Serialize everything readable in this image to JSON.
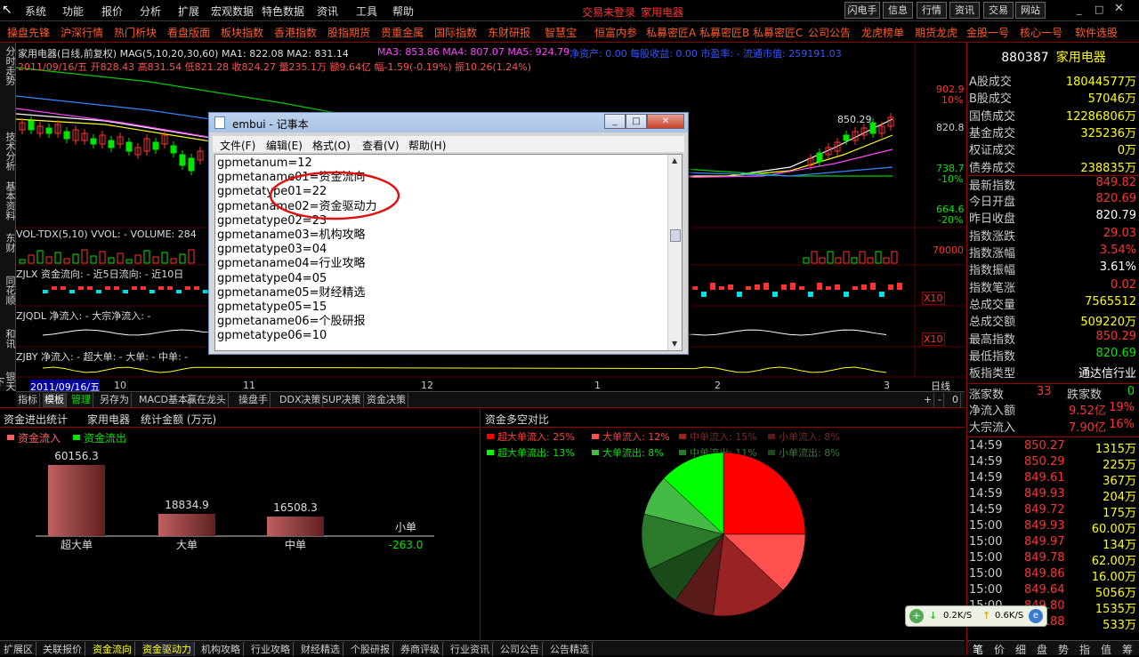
{
  "colors": {
    "up": "#ff3232",
    "down": "#00e600",
    "accent": "#ffff00",
    "nav": "#ff5a2a"
  },
  "menubar": {
    "items": [
      "系统",
      "功能",
      "报价",
      "分析",
      "扩展",
      "宏观数据",
      "特色数据",
      "资讯",
      "工具",
      "帮助"
    ],
    "status": "交易未登录",
    "stock": "家用电器",
    "buttons": [
      "闪电手",
      "信息",
      "行情",
      "资讯",
      "交易",
      "网站"
    ]
  },
  "navbar": {
    "items": [
      "操盘先锋",
      "沪深行情",
      "热门析块",
      "看盘版面",
      "板块指数",
      "香港指数",
      "股指期货",
      "贵重金属",
      "国际指数",
      "东财研报",
      "智慧宝",
      "恒富内参",
      "私募密匠A",
      "私募密匠B",
      "私募密匠C",
      "公司公告",
      "龙虎榜单",
      "期货龙虎",
      "金股一号",
      "核心一号",
      "软件选股"
    ]
  },
  "left_tabs": [
    "分时走势",
    "技术分析",
    "基本资料",
    "东财",
    "同花顺",
    "和讯",
    "银天下"
  ],
  "chart": {
    "title_line": "家用电器(日线,前复权) MAG(5,10,20,30,60) MA1: 822.08  MA2: 831.14",
    "ma_extra": "MA3: 853.86  MA4: 807.07  MA5: 924.79",
    "extra_info": "净资产: 0.00  每股收益: 0.00  市盈率: - 流通市值: 259191.03",
    "date_line": "2011/09/16/五 开828.43 高831.54 低821.28 收824.27 量235.1万 额9.64亿 幅-1.59(-0.19%) 振10.26(1.24%)",
    "price_labels": [
      "902.9",
      "10%",
      "820.8",
      "738.7",
      "-10%",
      "664.6",
      "-20%"
    ],
    "high_label": "850.29",
    "vol_title": "VOL-TDX(5,10) VVOL: -  VOLUME: 284",
    "vol_scale": "70000",
    "zjlx_title": "ZJLX 资金流向: -   近5日流向: -   近10日",
    "zjqdl_title": "ZJQDL 净流入: - 大宗净流入: -",
    "zjby_title": "ZJBY 净流入: -  超大单: -  大单: -  中单: -",
    "x10a": "X10",
    "x10b": "X10",
    "date_axis": [
      "2011/09/16/五",
      "10",
      "11",
      "12",
      "1",
      "2",
      "3"
    ],
    "period": "日线",
    "zoom_buttons": [
      "+",
      "-",
      "0"
    ]
  },
  "tabs": [
    "指标",
    "模板",
    "管理",
    "另存为",
    "MACD基本",
    "赢在龙头",
    "操盘手",
    "DDX决策",
    "SUP决策",
    "资金决策"
  ],
  "capital_stats": {
    "title": "资金进出统计",
    "stock": "家用电器",
    "unit_label": "统计金额 (万元)",
    "legend_in": "资金流入",
    "legend_out": "资金流出",
    "bars": [
      {
        "name": "超大单",
        "value": "60156.3",
        "num": 60156.3
      },
      {
        "name": "大单",
        "value": "18834.9",
        "num": 18834.9
      },
      {
        "name": "中单",
        "value": "16508.3",
        "num": 16508.3
      },
      {
        "name": "小单",
        "value": "-263.0",
        "num": -263.0
      }
    ]
  },
  "pie": {
    "title": "资金多空对比",
    "legend": [
      {
        "label": "超大单流入: 25%",
        "color": "#ff0000"
      },
      {
        "label": "大单流入: 12%",
        "color": "#ff5050"
      },
      {
        "label": "中单流入: 15%",
        "color": "#992222"
      },
      {
        "label": "小单流入: 8%",
        "color": "#5a1a1a"
      },
      {
        "label": "超大单流出: 13%",
        "color": "#00ff00"
      },
      {
        "label": "大单流出: 8%",
        "color": "#44bb44"
      },
      {
        "label": "中单流出: 11%",
        "color": "#2a7a2a"
      },
      {
        "label": "小单流出: 8%",
        "color": "#1a4a1a"
      }
    ]
  },
  "chart_data": {
    "type": "pie",
    "categories": [
      "超大单流入",
      "大单流入",
      "中单流入",
      "小单流入",
      "小单流出",
      "中单流出",
      "大单流出",
      "超大单流出"
    ],
    "values": [
      25,
      12,
      15,
      8,
      8,
      11,
      8,
      13
    ],
    "title": "资金多空对比"
  },
  "right_panel": {
    "code": "880387",
    "name": "家用电器",
    "rows": [
      {
        "l": "A股成交",
        "v": "18044577万",
        "c": "#ffff00"
      },
      {
        "l": "B股成交",
        "v": "57046万",
        "c": "#ffff00"
      },
      {
        "l": "国债成交",
        "v": "12286806万",
        "c": "#ffff00"
      },
      {
        "l": "基金成交",
        "v": "325236万",
        "c": "#ffff00"
      },
      {
        "l": "权证成交",
        "v": "0万",
        "c": "#ffff00"
      },
      {
        "l": "债券成交",
        "v": "238835万",
        "c": "#ffff00"
      },
      {
        "l": "最新指数",
        "v": "849.82",
        "c": "#ff3232"
      },
      {
        "l": "今日开盘",
        "v": "820.69",
        "c": "#ff3232"
      },
      {
        "l": "昨日收盘",
        "v": "820.79",
        "c": "#ffffff"
      },
      {
        "l": "指数涨跌",
        "v": "29.03",
        "c": "#ff3232"
      },
      {
        "l": "指数涨幅",
        "v": "3.54%",
        "c": "#ff3232"
      },
      {
        "l": "指数振幅",
        "v": "3.61%",
        "c": "#ffffff"
      },
      {
        "l": "指数笔涨",
        "v": "0.02",
        "c": "#ff3232"
      },
      {
        "l": "总成交量",
        "v": "7565512",
        "c": "#ffff00"
      },
      {
        "l": "总成交额",
        "v": "509220万",
        "c": "#ffff00"
      },
      {
        "l": "最高指数",
        "v": "850.29",
        "c": "#ff3232"
      },
      {
        "l": "最低指数",
        "v": "820.69",
        "c": "#00e600"
      },
      {
        "l": "板指类型",
        "v": "通达信行业",
        "c": "#ffffff"
      }
    ],
    "rise_label": "涨家数",
    "rise": "33",
    "fall_label": "跌家数",
    "fall": "0",
    "net_in_label": "净流入额",
    "net_in": "9.52亿",
    "net_in_pct": "19%",
    "block_in_label": "大宗流入",
    "block_in": "7.90亿",
    "block_in_pct": "16%",
    "ticks": [
      {
        "t": "14:59",
        "p": "850.27",
        "v": "1315万"
      },
      {
        "t": "14:59",
        "p": "850.29",
        "v": "225万"
      },
      {
        "t": "14:59",
        "p": "849.61",
        "v": "367万"
      },
      {
        "t": "14:59",
        "p": "849.93",
        "v": "204万"
      },
      {
        "t": "14:59",
        "p": "849.72",
        "v": "175万"
      },
      {
        "t": "15:00",
        "p": "849.93",
        "v": "60.00万"
      },
      {
        "t": "15:00",
        "p": "849.97",
        "v": "134万"
      },
      {
        "t": "15:00",
        "p": "849.78",
        "v": "62.00万"
      },
      {
        "t": "15:00",
        "p": "849.86",
        "v": "16.00万"
      },
      {
        "t": "15:00",
        "p": "849.64",
        "v": "5056万"
      },
      {
        "t": "15:00",
        "p": "849.80",
        "v": "1535万"
      },
      {
        "t": "15:00",
        "p": "849.88",
        "v": "533万"
      }
    ],
    "bottom_tabs": [
      "笔",
      "价",
      "细",
      "盘",
      "势",
      "指",
      "值",
      "筹"
    ],
    "speed_down": "0.2K/S",
    "speed_up": "0.6K/S"
  },
  "statusbar": [
    "扩展区",
    "关联报价",
    "资金流向",
    "资金驱动力",
    "机构攻略",
    "行业攻略",
    "财经精选",
    "个股研报",
    "券商评级",
    "行业资讯",
    "公司公告",
    "公告精选"
  ],
  "notepad": {
    "title": "embui - 记事本",
    "menu": [
      "文件(F)",
      "编辑(E)",
      "格式(O)",
      "查看(V)",
      "帮助(H)"
    ],
    "lines": [
      "gpmetanum=12",
      "gpmetaname01=资金流向",
      "gpmetatype01=22",
      "gpmetaname02=资金驱动力",
      "gpmetatype02=23",
      "gpmetaname03=机构攻略",
      "gpmetatype03=04",
      "gpmetaname04=行业攻略",
      "gpmetatype04=05",
      "gpmetaname05=财经精选",
      "gpmetatype05=15",
      "gpmetaname06=个股研报",
      "gpmetatype06=10"
    ]
  }
}
